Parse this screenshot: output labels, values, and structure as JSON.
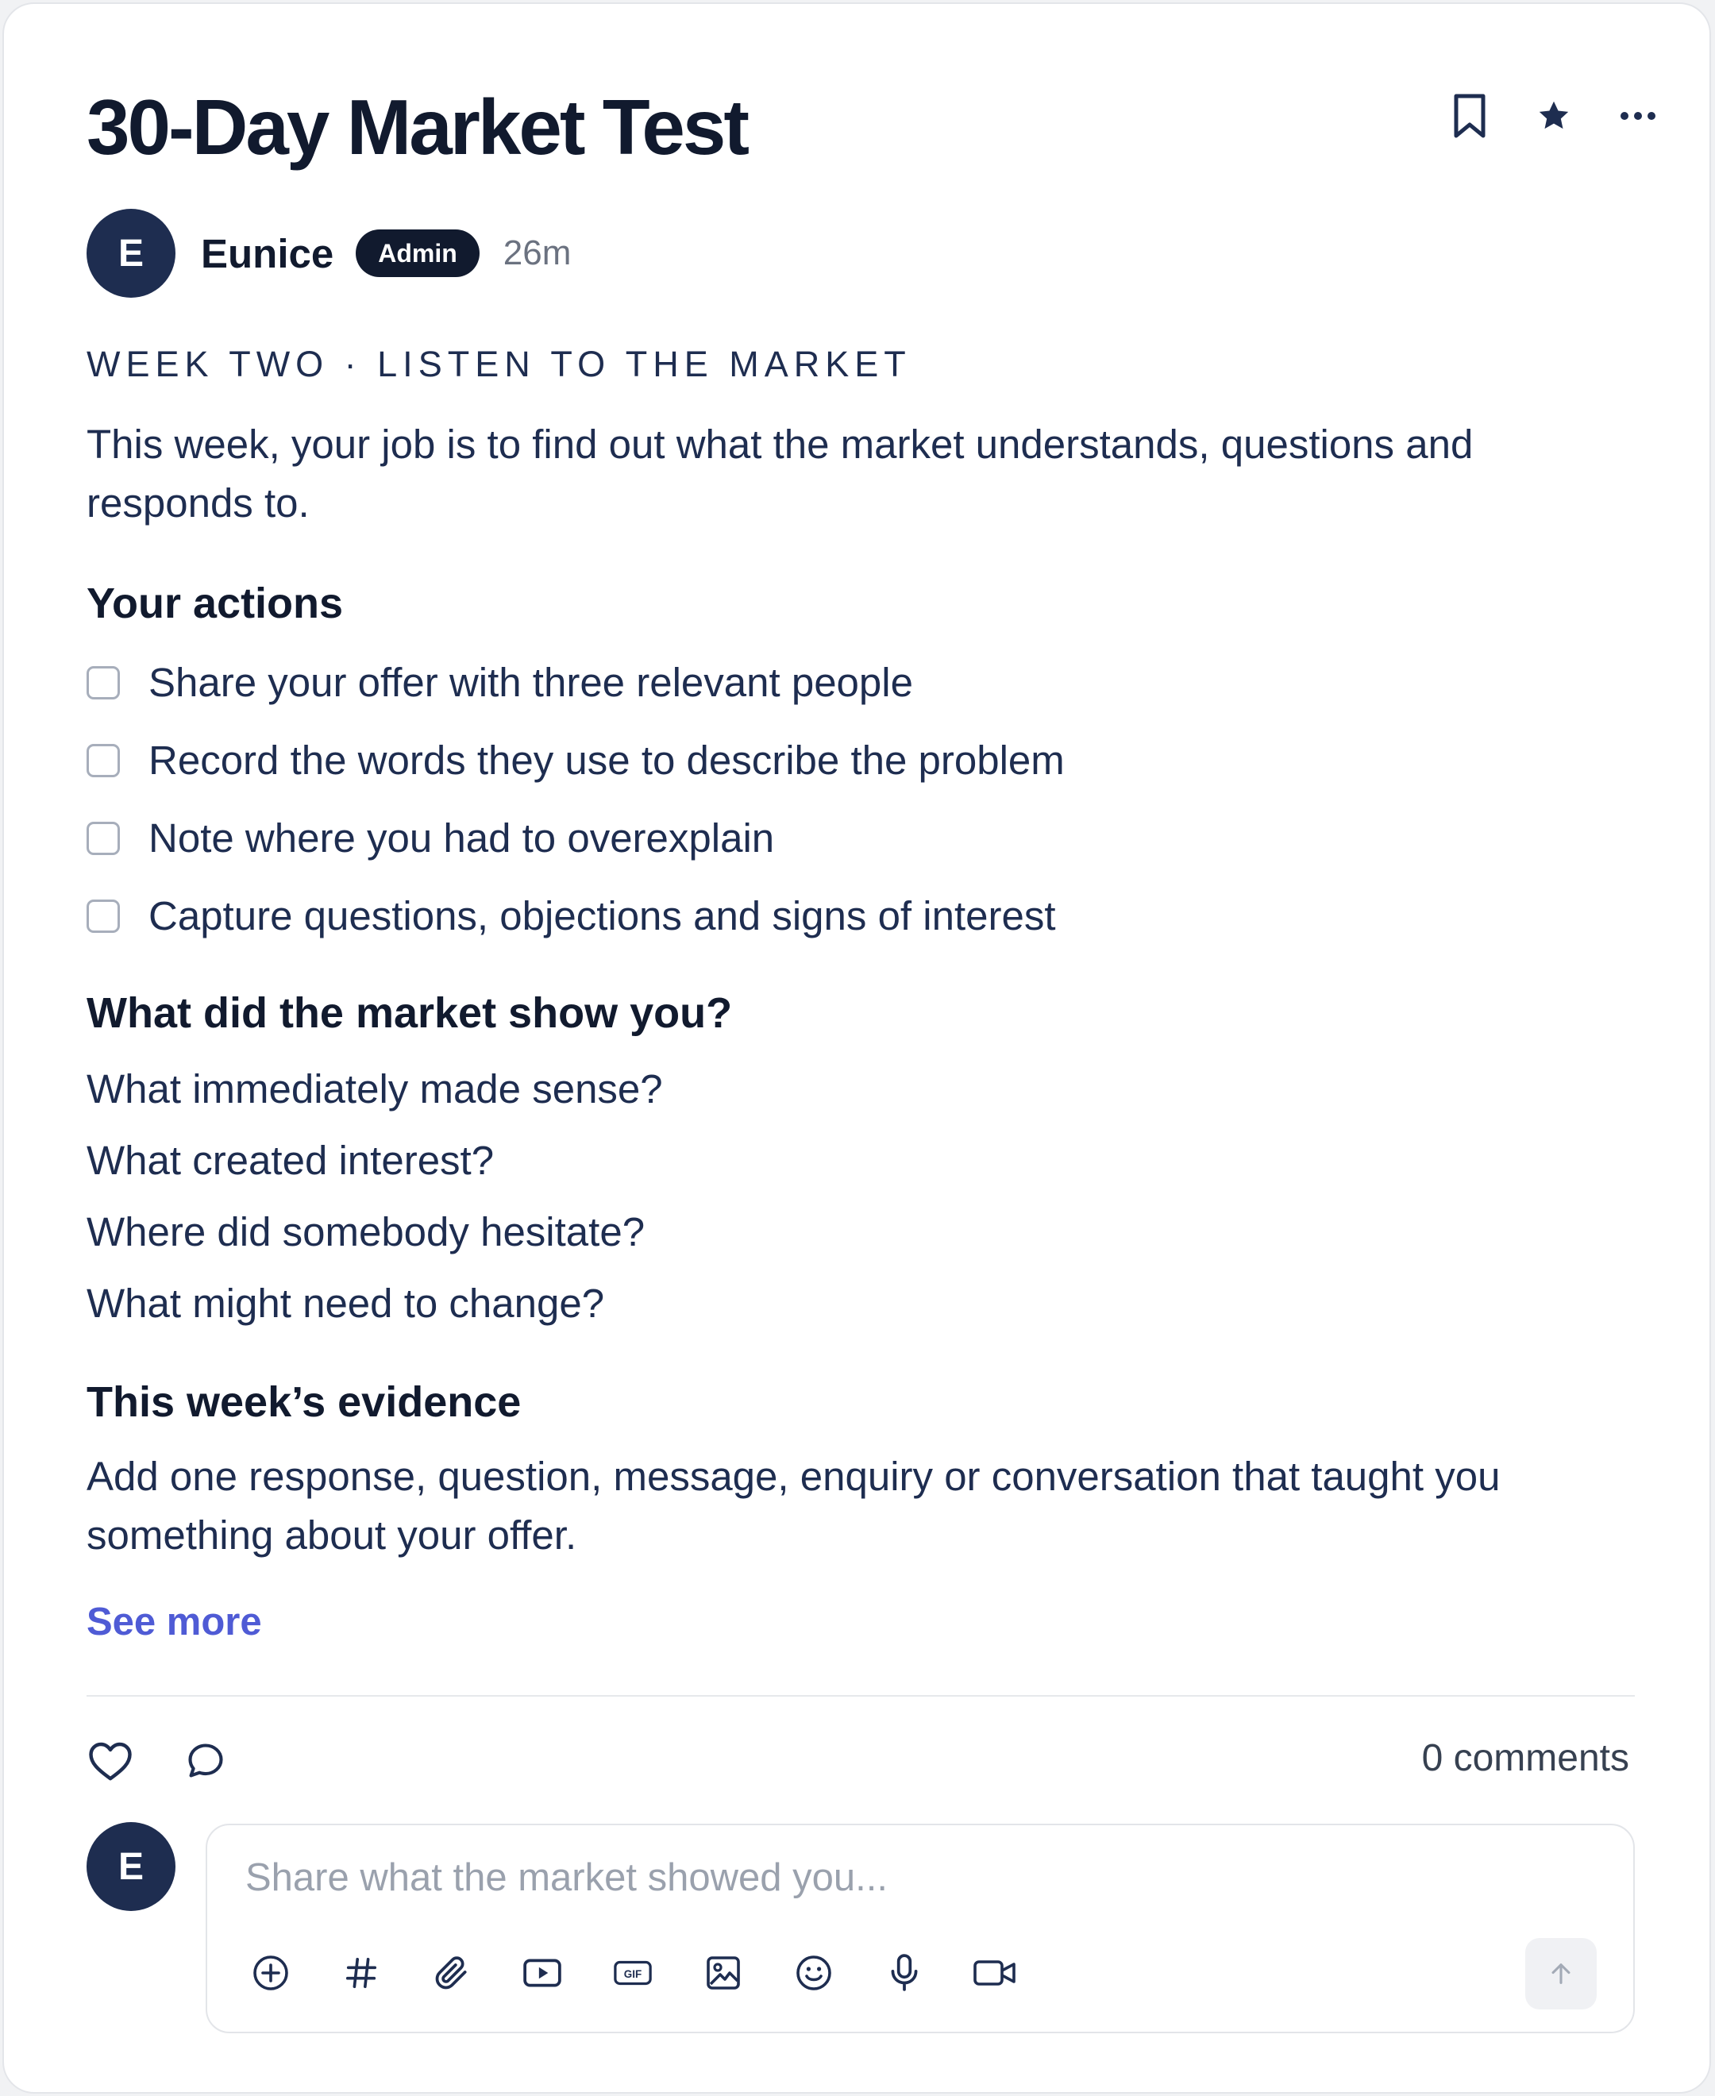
{
  "post": {
    "title": "30-Day Market Test",
    "author": {
      "initial": "E",
      "name": "Eunice",
      "role_badge": "Admin",
      "time": "26m"
    },
    "eyebrow": "WEEK TWO · LISTEN TO THE MARKET",
    "intro": "This week, your job is to find out what the market understands, questions and responds to.",
    "actions_heading": "Your actions",
    "actions": [
      {
        "label": "Share your offer with three relevant people",
        "checked": false
      },
      {
        "label": "Record the words they use to describe the problem",
        "checked": false
      },
      {
        "label": "Note where you had to overexplain",
        "checked": false
      },
      {
        "label": "Capture questions, objections and signs of interest",
        "checked": false
      }
    ],
    "reflect_heading": "What did the market show you?",
    "reflect_questions": [
      "What immediately made sense?",
      "What created interest?",
      "Where did somebody hesitate?",
      "What might need to change?"
    ],
    "evidence_heading": "This week’s evidence",
    "evidence_text": "Add one response, question, message, enquiry or conversation that taught you something about your offer.",
    "see_more": "See more"
  },
  "header_icons": [
    "bookmark-icon",
    "star-icon",
    "more-icon"
  ],
  "footer": {
    "comments_count": "0 comments"
  },
  "composer": {
    "avatar_initial": "E",
    "placeholder": "Share what the market showed you...",
    "tools": [
      "add-icon",
      "hashtag-icon",
      "attach-icon",
      "video-embed-icon",
      "gif-icon",
      "image-icon",
      "emoji-icon",
      "microphone-icon",
      "video-camera-icon"
    ]
  },
  "colors": {
    "avatar": "#1e2d50",
    "link": "#4f5bd5",
    "text": "#1e2d50",
    "badge": "#111a2e"
  }
}
